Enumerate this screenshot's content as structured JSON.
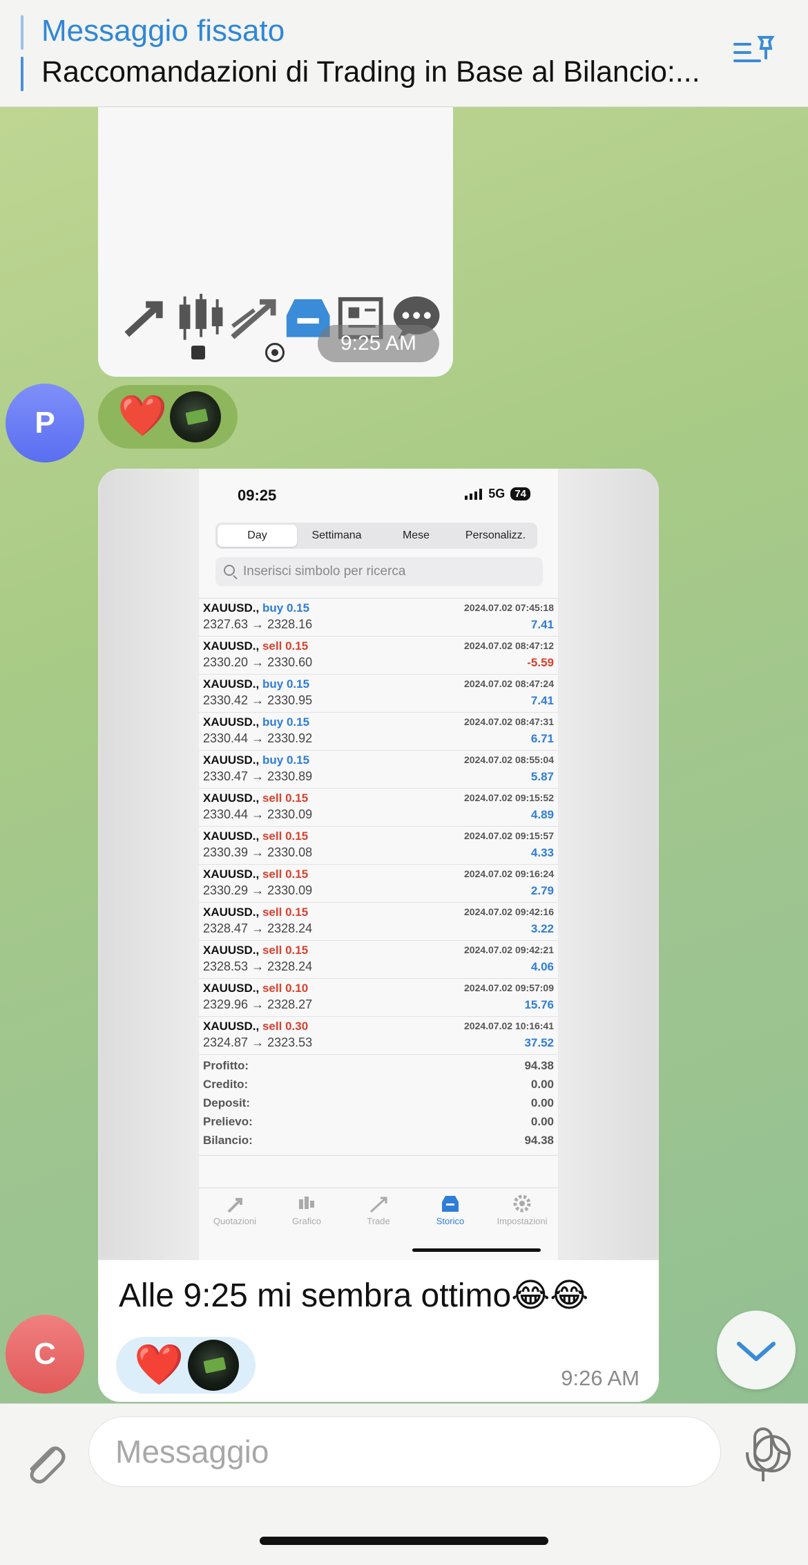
{
  "pinned": {
    "title": "Messaggio fissato",
    "text": "Raccomandazioni di Trading in Base al Bilancio:..."
  },
  "first_message": {
    "time": "9:25 AM",
    "icons": [
      "quotes-icon",
      "chart-icon",
      "trade-icon",
      "history-icon",
      "news-icon",
      "chat-icon"
    ]
  },
  "reaction_sender_initial": "P",
  "reactions_out": [
    "❤️"
  ],
  "screenshot": {
    "status_time": "09:25",
    "network": "5G",
    "battery": "74",
    "segments": [
      "Day",
      "Settimana",
      "Mese",
      "Personalizz."
    ],
    "selected_segment": "Day",
    "search_placeholder": "Inserisci simbolo per ricerca",
    "trades": [
      {
        "symbol": "XAUUSD.,",
        "side": "buy",
        "volume": "0.15",
        "prices": "2327.63 → 2328.16",
        "datetime": "2024.07.02 07:45:18",
        "profit": "7.41"
      },
      {
        "symbol": "XAUUSD.,",
        "side": "sell",
        "volume": "0.15",
        "prices": "2330.20 → 2330.60",
        "datetime": "2024.07.02 08:47:12",
        "profit": "-5.59"
      },
      {
        "symbol": "XAUUSD.,",
        "side": "buy",
        "volume": "0.15",
        "prices": "2330.42 → 2330.95",
        "datetime": "2024.07.02 08:47:24",
        "profit": "7.41"
      },
      {
        "symbol": "XAUUSD.,",
        "side": "buy",
        "volume": "0.15",
        "prices": "2330.44 → 2330.92",
        "datetime": "2024.07.02 08:47:31",
        "profit": "6.71"
      },
      {
        "symbol": "XAUUSD.,",
        "side": "buy",
        "volume": "0.15",
        "prices": "2330.47 → 2330.89",
        "datetime": "2024.07.02 08:55:04",
        "profit": "5.87"
      },
      {
        "symbol": "XAUUSD.,",
        "side": "sell",
        "volume": "0.15",
        "prices": "2330.44 → 2330.09",
        "datetime": "2024.07.02 09:15:52",
        "profit": "4.89"
      },
      {
        "symbol": "XAUUSD.,",
        "side": "sell",
        "volume": "0.15",
        "prices": "2330.39 → 2330.08",
        "datetime": "2024.07.02 09:15:57",
        "profit": "4.33"
      },
      {
        "symbol": "XAUUSD.,",
        "side": "sell",
        "volume": "0.15",
        "prices": "2330.29 → 2330.09",
        "datetime": "2024.07.02 09:16:24",
        "profit": "2.79"
      },
      {
        "symbol": "XAUUSD.,",
        "side": "sell",
        "volume": "0.15",
        "prices": "2328.47 → 2328.24",
        "datetime": "2024.07.02 09:42:16",
        "profit": "3.22"
      },
      {
        "symbol": "XAUUSD.,",
        "side": "sell",
        "volume": "0.15",
        "prices": "2328.53 → 2328.24",
        "datetime": "2024.07.02 09:42:21",
        "profit": "4.06"
      },
      {
        "symbol": "XAUUSD.,",
        "side": "sell",
        "volume": "0.10",
        "prices": "2329.96 → 2328.27",
        "datetime": "2024.07.02 09:57:09",
        "profit": "15.76"
      },
      {
        "symbol": "XAUUSD.,",
        "side": "sell",
        "volume": "0.30",
        "prices": "2324.87 → 2323.53",
        "datetime": "2024.07.02 10:16:41",
        "profit": "37.52"
      }
    ],
    "summary": [
      {
        "label": "Profitto:",
        "value": "94.38"
      },
      {
        "label": "Credito:",
        "value": "0.00"
      },
      {
        "label": "Deposit:",
        "value": "0.00"
      },
      {
        "label": "Prelievo:",
        "value": "0.00"
      },
      {
        "label": "Bilancio:",
        "value": "94.38"
      }
    ],
    "tabs": [
      {
        "label": "Quotazioni",
        "icon": "quotes-icon",
        "active": false
      },
      {
        "label": "Grafico",
        "icon": "chart-icon",
        "active": false
      },
      {
        "label": "Trade",
        "icon": "trade-icon",
        "active": false
      },
      {
        "label": "Storico",
        "icon": "history-icon",
        "active": true
      },
      {
        "label": "Impostazioni",
        "icon": "gear-icon",
        "active": false
      }
    ]
  },
  "second_message": {
    "caption": "Alle 9:25 mi sembra ottimo😂😂",
    "time": "9:26 AM",
    "reactions": [
      "❤️"
    ]
  },
  "reaction_sender_initial_2": "C",
  "composer": {
    "placeholder": "Messaggio"
  },
  "colors": {
    "accent": "#2f87d6",
    "buy": "#2e7dd8",
    "sell": "#d8412e",
    "avatar_p": "#6a7cf5",
    "avatar_c": "#e86a6a"
  }
}
